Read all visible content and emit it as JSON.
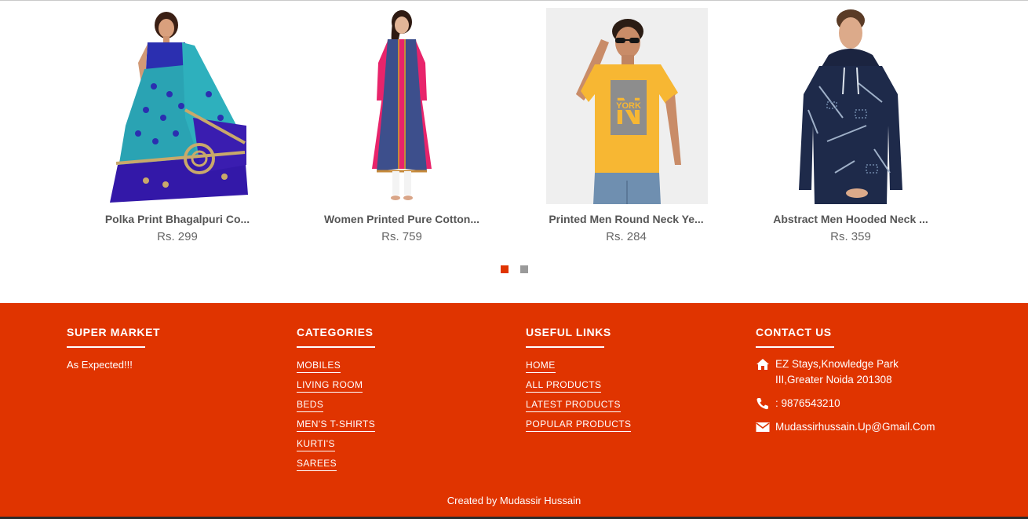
{
  "colors": {
    "accent": "#e03400",
    "dot_active": "#e03400",
    "dot_inactive": "#9a9a9a"
  },
  "products": [
    {
      "name": "Polka Print Bhagalpuri Co...",
      "price": "Rs. 299",
      "image_icon": "saree-image"
    },
    {
      "name": "Women Printed Pure Cotton...",
      "price": "Rs. 759",
      "image_icon": "kurti-image"
    },
    {
      "name": "Printed Men Round Neck Ye...",
      "price": "Rs. 284",
      "image_icon": "yellow-tshirt-image",
      "print_text": "YORK"
    },
    {
      "name": "Abstract Men Hooded Neck ...",
      "price": "Rs. 359",
      "image_icon": "hooded-tshirt-image"
    }
  ],
  "carousel": {
    "pages": 2,
    "active": 1
  },
  "footer": {
    "brand": {
      "title": "SUPER MARKET",
      "tagline": "As Expected!!!"
    },
    "categories": {
      "title": "CATEGORIES",
      "items": [
        "MOBILES",
        "LIVING ROOM",
        "BEDS",
        "MEN'S T-SHIRTS",
        "KURTI'S",
        "SAREES"
      ]
    },
    "useful_links": {
      "title": "USEFUL LINKS",
      "items": [
        "HOME",
        "ALL PRODUCTS",
        "LATEST PRODUCTS",
        "POPULAR PRODUCTS"
      ]
    },
    "contact": {
      "title": "CONTACT US",
      "address_line1": "EZ Stays,Knowledge Park",
      "address_line2": "III,Greater Noida 201308",
      "phone": ": 9876543210",
      "email": "Mudassirhussain.Up@Gmail.Com",
      "icons": [
        "home-icon",
        "phone-icon",
        "envelope-icon"
      ]
    },
    "credit": "Created by Mudassir Hussain"
  }
}
